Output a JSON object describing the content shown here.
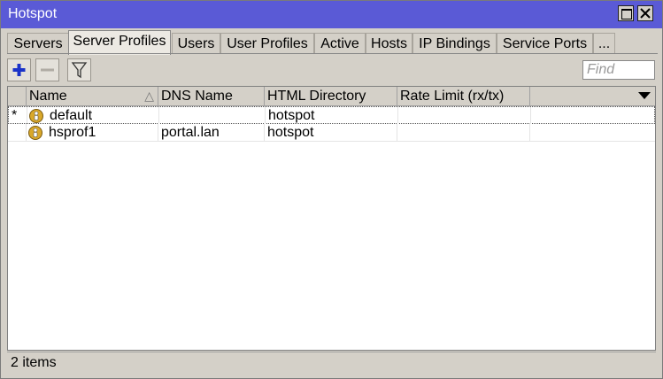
{
  "window": {
    "title": "Hotspot"
  },
  "tabs": [
    {
      "label": "Servers"
    },
    {
      "label": "Server Profiles"
    },
    {
      "label": "Users"
    },
    {
      "label": "User Profiles"
    },
    {
      "label": "Active"
    },
    {
      "label": "Hosts"
    },
    {
      "label": "IP Bindings"
    },
    {
      "label": "Service Ports"
    },
    {
      "label": "..."
    }
  ],
  "active_tab": "Server Profiles",
  "toolbar": {
    "add_icon": "plus-icon",
    "remove_icon": "minus-icon",
    "filter_icon": "filter-icon",
    "find_placeholder": "Find"
  },
  "table": {
    "columns": [
      "Name",
      "DNS Name",
      "HTML Directory",
      "Rate Limit (rx/tx)"
    ],
    "sort_indicator": "△",
    "rows": [
      {
        "flag": "*",
        "icon": "profile-icon",
        "name": "default",
        "dns_name": "",
        "html_directory": "hotspot",
        "rate_limit": ""
      },
      {
        "flag": "",
        "icon": "profile-icon",
        "name": "hsprof1",
        "dns_name": "portal.lan",
        "html_directory": "hotspot",
        "rate_limit": ""
      }
    ]
  },
  "status": {
    "item_count": "2 items"
  },
  "colors": {
    "titlebar": "#5a5ad6",
    "add_icon": "#1a32c8",
    "profile_icon": "#d9a82a"
  }
}
